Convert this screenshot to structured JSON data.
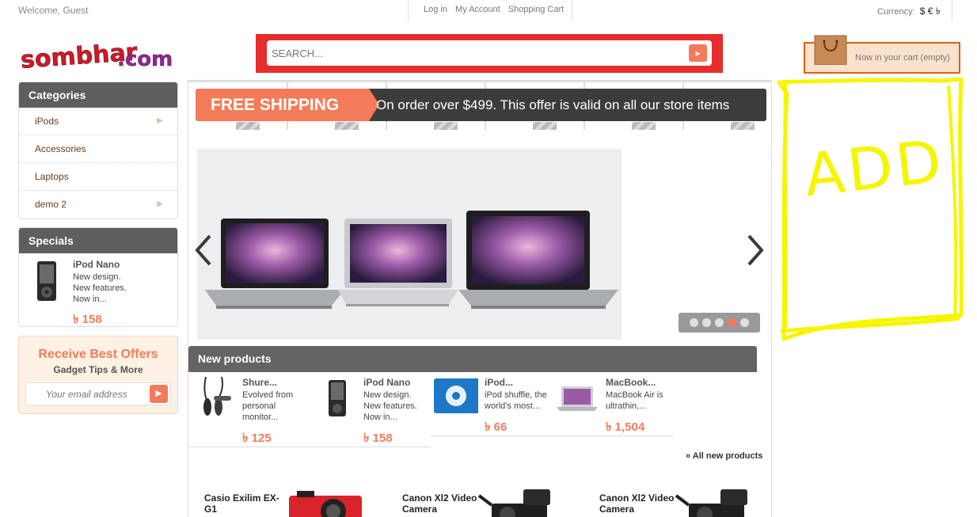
{
  "topbar": {
    "welcome": "Welcome, Guest",
    "links": [
      "Log in",
      "My Account",
      "Shopping Cart"
    ],
    "currency_label": "Currency:",
    "currency_symbols": "$ € ৳"
  },
  "logo": {
    "text": "sombhar.com"
  },
  "search": {
    "placeholder": "SEARCH...",
    "button_icon": "arrow-right-icon"
  },
  "cart": {
    "text": "Now in your cart (empty)",
    "icon": "shopping-bag-icon"
  },
  "categories": {
    "title": "Categories",
    "items": [
      {
        "label": "iPods",
        "has_sub": true
      },
      {
        "label": "Accessories",
        "has_sub": false
      },
      {
        "label": "Laptops",
        "has_sub": false
      },
      {
        "label": "demo 2",
        "has_sub": true
      }
    ]
  },
  "specials": {
    "title": "Specials",
    "item": {
      "name": "iPod Nano",
      "desc_lines": [
        "New design.",
        "New features.",
        "Now in..."
      ],
      "price": "৳ 158"
    }
  },
  "offers": {
    "title": "Receive Best Offers",
    "subtitle": "Gadget Tips & More",
    "email_placeholder": "Your email address"
  },
  "banner": {
    "tag": "FREE SHIPPING",
    "message": "On order over $499. This offer is valid on all our store items"
  },
  "slider": {
    "dots": 5,
    "active_dot": 4
  },
  "new_products": {
    "title": "New products",
    "items": [
      {
        "name": "Shure...",
        "desc_lines": [
          "Evolved from",
          "personal",
          "monitor..."
        ],
        "price": "৳ 125",
        "image": "earphones"
      },
      {
        "name": "iPod Nano",
        "desc_lines": [
          "New design.",
          "New features.",
          "Now in..."
        ],
        "price": "৳ 158",
        "image": "ipod-nano"
      },
      {
        "name": "iPod...",
        "desc_lines": [
          "iPod shuffle, the",
          "world's most..."
        ],
        "price": "৳ 66",
        "image": "ipod-shuffle"
      },
      {
        "name": "MacBook...",
        "desc_lines": [
          "MacBook Air is",
          "ultrathin,..."
        ],
        "price": "৳ 1,504",
        "image": "macbook-air"
      }
    ],
    "all_link": "» All new products"
  },
  "bottom_products": [
    {
      "name": "Casio Exilim EX-G1",
      "image": "red-camera"
    },
    {
      "name": "Canon Xl2 Video Camera",
      "image": "video-camera"
    },
    {
      "name": "Canon Xl2 Video Camera",
      "image": "video-camera"
    }
  ],
  "advert": {
    "text": "ADD",
    "color": "#f5f500"
  },
  "colors": {
    "accent": "#f47b59",
    "search_border": "#e52d2d",
    "header_grey": "#5e5e5e",
    "cart_border": "#e06010"
  }
}
